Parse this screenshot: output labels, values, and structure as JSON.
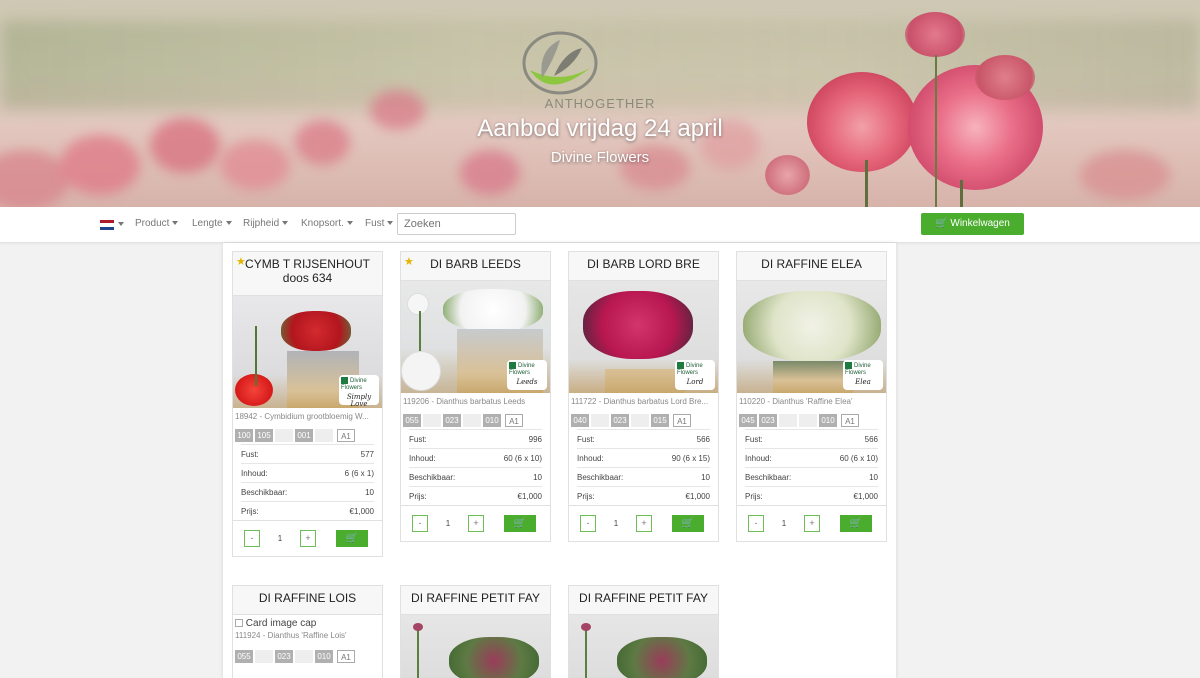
{
  "hero": {
    "brand": "ANTHOGETHER",
    "title": "Aanbod vrijdag 24 april",
    "subtitle": "Divine Flowers"
  },
  "nav": {
    "language_icon": "netherlands-flag-icon",
    "menus": [
      "Product",
      "Lengte",
      "Rijpheid",
      "Knopsort.",
      "Fust"
    ],
    "search_placeholder": "Zoeken",
    "cart_label": "Winkelwagen",
    "cart_icon": "cart-icon"
  },
  "labels": {
    "fust": "Fust:",
    "inhoud": "Inhoud:",
    "beschikbaar": "Beschikbaar:",
    "prijs": "Prijs:",
    "minus": "-",
    "plus": "+"
  },
  "products": [
    {
      "name": "CYMB T RIJSENHOUT doos 634",
      "favorite": true,
      "description": "18942 - Cymbidium grootbloemig W...",
      "codes": [
        "100",
        "105",
        "",
        "001",
        ""
      ],
      "grade": "A1",
      "fust": "577",
      "inhoud": "6  (6 x 1)",
      "beschikbaar": "10",
      "prijs": "€1,000",
      "qty": "1",
      "tag_script": "Simply Love"
    },
    {
      "name": "DI BARB LEEDS",
      "favorite": true,
      "description": "119206 - Dianthus barbatus Leeds",
      "codes": [
        "055",
        "",
        "023",
        "",
        "010"
      ],
      "grade": "A1",
      "fust": "996",
      "inhoud": "60  (6 x 10)",
      "beschikbaar": "10",
      "prijs": "€1,000",
      "qty": "1",
      "tag_script": "Leeds"
    },
    {
      "name": "DI BARB LORD BRE",
      "favorite": false,
      "description": "111722 - Dianthus barbatus Lord Bre...",
      "codes": [
        "040",
        "",
        "023",
        "",
        "015"
      ],
      "grade": "A1",
      "fust": "566",
      "inhoud": "90  (6 x 15)",
      "beschikbaar": "10",
      "prijs": "€1,000",
      "qty": "1",
      "tag_script": "Lord"
    },
    {
      "name": "DI RAFFINE ELEA",
      "favorite": false,
      "description": "110220 - Dianthus 'Raffine Elea'",
      "codes": [
        "045",
        "023",
        "",
        "",
        "010"
      ],
      "grade": "A1",
      "fust": "566",
      "inhoud": "60  (6 x 10)",
      "beschikbaar": "10",
      "prijs": "€1,000",
      "qty": "1",
      "tag_script": "Elea"
    },
    {
      "name": "DI RAFFINE LOIS",
      "favorite": false,
      "image_alt": "Card image cap",
      "description": "111924 - Dianthus 'Raffine Lois'",
      "codes": [
        "055",
        "",
        "023",
        "",
        "010"
      ],
      "grade": "A1"
    },
    {
      "name": "DI RAFFINE PETIT FAY",
      "favorite": false
    },
    {
      "name": "DI RAFFINE PETIT FAY",
      "favorite": false
    }
  ],
  "brand_tag": "Divine Flowers",
  "colors": {
    "accent_green": "#4aad2e",
    "star": "#e6b400"
  }
}
